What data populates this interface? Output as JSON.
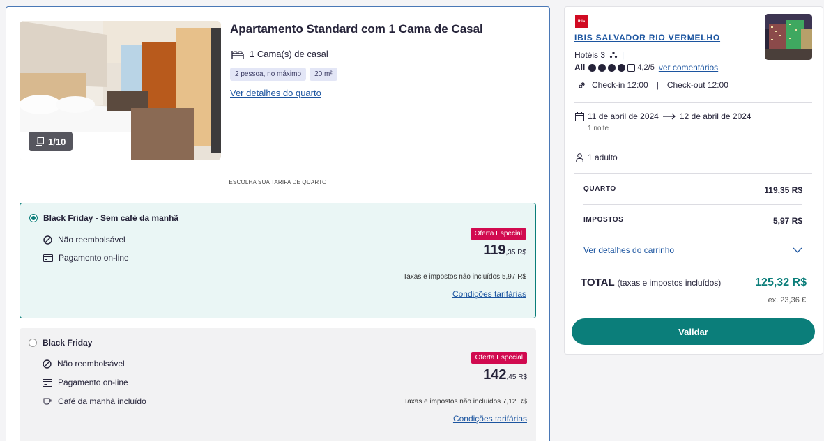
{
  "room": {
    "title": "Apartamento Standard com 1 Cama de Casal",
    "beds": "1 Cama(s) de casal",
    "chips": [
      "2 pessoa, no máximo",
      "20 m²"
    ],
    "details_link": "Ver detalhes do quarto",
    "photo_counter": "1/10"
  },
  "rate_section_label": "ESCOLHA SUA TARIFA DE QUARTO",
  "rates": [
    {
      "name": "Black Friday - Sem café da manhã",
      "selected": true,
      "features": [
        "Não reembolsável",
        "Pagamento on-line"
      ],
      "feature_icons": [
        "no-refund-icon",
        "credit-card-icon"
      ],
      "badge": "Oferta Especial",
      "price_main": "119",
      "price_small": ",35 R$",
      "taxes": "Taxas e impostos não incluídos 5,97 R$",
      "conditions": "Condições tarifárias"
    },
    {
      "name": "Black Friday",
      "selected": false,
      "features": [
        "Não reembolsável",
        "Pagamento on-line",
        "Café da manhã incluído"
      ],
      "feature_icons": [
        "no-refund-icon",
        "credit-card-icon",
        "coffee-icon"
      ],
      "badge": "Oferta Especial",
      "price_main": "142",
      "price_small": ",45 R$",
      "taxes": "Taxas e impostos não incluídos 7,12 R$",
      "conditions": "Condições tarifárias"
    }
  ],
  "summary": {
    "brand_logo": "ibis",
    "hotel_name": "IBIS SALVADOR RIO VERMELHO",
    "category": "Hotéis 3",
    "rating_brand": "All",
    "rating_score": "4,2/5",
    "rating_value": 4.2,
    "reviews_link": "ver comentários",
    "checkin": "Check-in 12:00",
    "separator": "|",
    "checkout": "Check-out 12:00",
    "date_from": "11 de abril de 2024",
    "date_to": "12 de abril de 2024",
    "nights": "1 noite",
    "guests": "1 adulto",
    "lines": [
      {
        "label": "QUARTO",
        "value": "119,35 R$"
      },
      {
        "label": "IMPOSTOS",
        "value": "5,97 R$"
      }
    ],
    "cart_link": "Ver detalhes do carrinho",
    "total_label": "TOTAL",
    "total_note": "(taxas e impostos incluídos)",
    "total_value": "125,32 R$",
    "total_excl": "ex. 23,36 €",
    "validate_button": "Validar"
  },
  "colors": {
    "accent": "#0b7e7a",
    "link": "#1c55a0",
    "badge": "#d10a4f",
    "brand": "#d10a22"
  }
}
